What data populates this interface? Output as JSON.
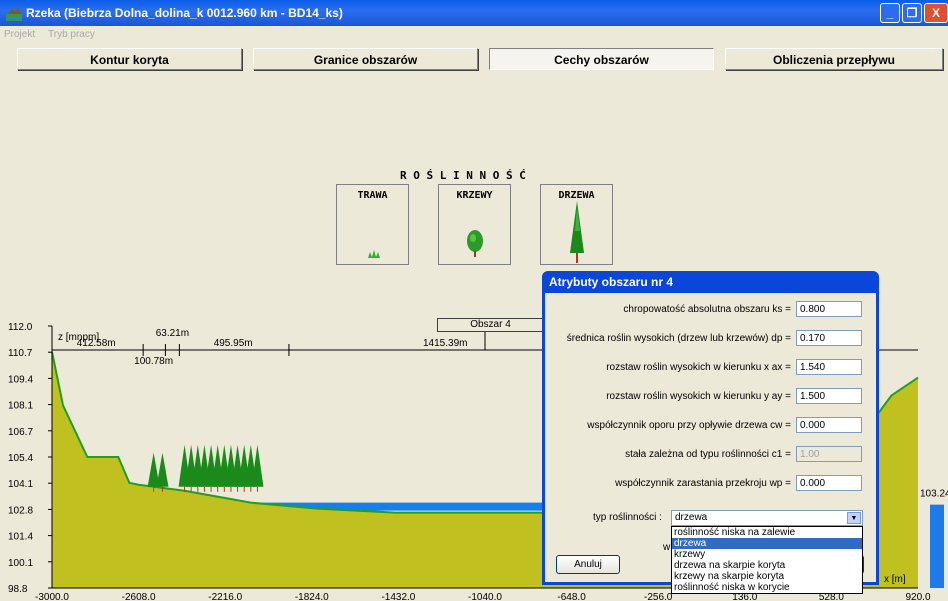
{
  "window": {
    "title": "Rzeka (Biebrza Dolna_dolina_k 0012.960 km  - BD14_ks)",
    "controls": [
      "_",
      "❐",
      "X"
    ]
  },
  "menu": [
    "Projekt",
    "Tryb pracy"
  ],
  "tabs": [
    {
      "label": "Kontur koryta",
      "active": false
    },
    {
      "label": "Granice obszarów",
      "active": false
    },
    {
      "label": "Cechy obszarów",
      "active": true
    },
    {
      "label": "Obliczenia przepływu",
      "active": false
    }
  ],
  "vegetation": {
    "heading": "R O Ś L I N N O Ś Ć",
    "boxes": [
      {
        "label": "TRAWA",
        "icon": "grass-icon"
      },
      {
        "label": "KRZEWY",
        "icon": "shrub-icon"
      },
      {
        "label": "DRZEWA",
        "icon": "tree-icon"
      }
    ]
  },
  "colors": {
    "terrain": "#c0c020",
    "water": "#1480f0",
    "vegetation": "#20a020",
    "titlebar": "#0a5de8",
    "gauge": "#1e7ae8"
  },
  "chart_data": {
    "type": "area",
    "ylabel": "z [mnpm]",
    "xlabel": "x [m]",
    "y_ticks": [
      "112.0",
      "110.7",
      "109.4",
      "108.1",
      "106.7",
      "105.4",
      "104.1",
      "102.8",
      "101.4",
      "100.1",
      "98.8"
    ],
    "x_ticks": [
      "-3000.0",
      "-2608.0",
      "-2216.0",
      "-1824.0",
      "-1432.0",
      "-1040.0",
      "-648.0",
      "-256.0",
      "136.0",
      "528.0",
      "920.0"
    ],
    "xlim": [
      -3000,
      920
    ],
    "ylim": [
      98.8,
      112.0
    ],
    "region_label": "Obszar 4",
    "segments": [
      "412.58m",
      "100.78m",
      "63.21m",
      "495.95m",
      "1415.39m"
    ],
    "water_level_label": "103.24",
    "terrain": {
      "x": [
        -3000,
        -2950,
        -2840,
        -2700,
        -2650,
        -2608,
        -2400,
        -2100,
        -1800,
        -1450,
        -1200,
        -900,
        -600,
        -300,
        0,
        100,
        200,
        400,
        600,
        700,
        800,
        920
      ],
      "z": [
        110.7,
        108.0,
        105.4,
        105.4,
        104.1,
        104.0,
        103.7,
        103.1,
        102.8,
        102.6,
        102.6,
        102.6,
        102.6,
        102.6,
        102.6,
        103.0,
        104.0,
        104.5,
        105.5,
        107.0,
        108.5,
        109.4
      ]
    },
    "water": {
      "x": [
        -2100,
        300
      ],
      "z": 102.9
    }
  },
  "dialog": {
    "title": "Atrybuty obszaru nr 4",
    "fields": [
      {
        "label": "chropowatość absolutna obszaru ks =",
        "value": "0.800",
        "disabled": false
      },
      {
        "label": "średnica roślin wysokich (drzew lub krzewów) dp =",
        "value": "0.170",
        "disabled": false
      },
      {
        "label": "rozstaw roślin wysokich w kierunku x ax =",
        "value": "1.540",
        "disabled": false
      },
      {
        "label": "rozstaw roślin wysokich w kierunku y ay =",
        "value": "1.500",
        "disabled": false
      },
      {
        "label": "współczynnik oporu przy opływie drzewa cw =",
        "value": "0.000",
        "disabled": false
      },
      {
        "label": "stała zależna od typu roślinności c1 =",
        "value": "1.00",
        "disabled": true
      },
      {
        "label": "współczynnik zarastania przekroju wp =",
        "value": "0.000",
        "disabled": false
      }
    ],
    "type_label": "typ roślinności :",
    "type_value": "drzewa",
    "options": [
      "roślinność niska na zalewie",
      "drzewa",
      "krzewy",
      "drzewa na skarpie koryta",
      "krzewy na skarpie koryta",
      "roślinność niska w korycie"
    ],
    "selected_option": "drzewa",
    "partial_text": "w",
    "cancel_label": "Anuluj"
  }
}
